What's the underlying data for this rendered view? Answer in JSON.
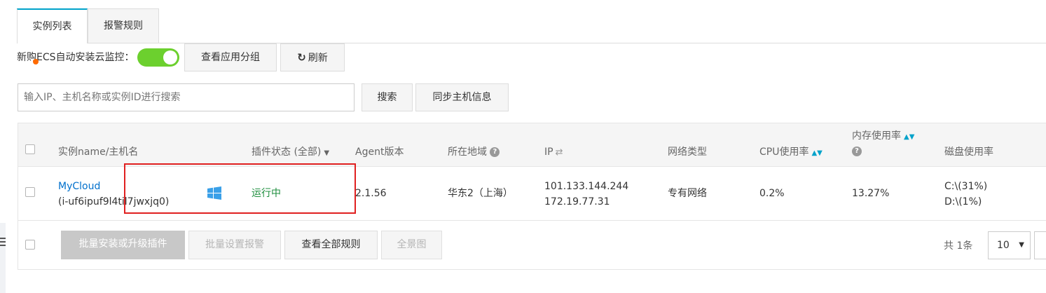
{
  "tabs": [
    {
      "label": "实例列表"
    },
    {
      "label": "报警规则"
    }
  ],
  "toolbar": {
    "auto_install_label": "新购ECS自动安装云监控：",
    "auto_install_enabled": true,
    "view_app_group_label": "查看应用分组",
    "refresh_label": "刷新"
  },
  "search": {
    "placeholder": "输入IP、主机名称或实例ID进行搜索",
    "search_label": "搜索",
    "sync_label": "同步主机信息"
  },
  "table": {
    "headers": {
      "name": "实例name/主机名",
      "plugin_status": "插件状态 (全部)",
      "agent_version": "Agent版本",
      "region": "所在地域",
      "ip": "IP",
      "network_type": "网络类型",
      "cpu": "CPU使用率",
      "memory": "内存使用率",
      "disk": "磁盘使用率"
    },
    "rows": [
      {
        "name": "MyCloud",
        "instance_id": "(i-uf6ipuf9l4til7jwxjq0)",
        "os_icon": "windows-icon",
        "plugin_status": "运行中",
        "agent_version": "2.1.56",
        "region": "华东2（上海）",
        "ip_public": "101.133.144.244",
        "ip_private": "172.19.77.31",
        "network_type": "专有网络",
        "cpu": "0.2%",
        "memory": "13.27%",
        "disk_c": "C:\\(31%)",
        "disk_d": "D:\\(1%)"
      }
    ]
  },
  "footer": {
    "batch_install_label": "批量安装或升级插件",
    "batch_alarm_label": "批量设置报警",
    "view_all_rules_label": "查看全部规则",
    "panorama_label": "全景图",
    "total_label": "共 1条",
    "page_size": "10"
  },
  "colors": {
    "accent": "#00a2ca",
    "toggle_on": "#6cd02e",
    "running": "#1e8e3e",
    "link": "#0070cc",
    "highlight_box": "#e02020"
  }
}
